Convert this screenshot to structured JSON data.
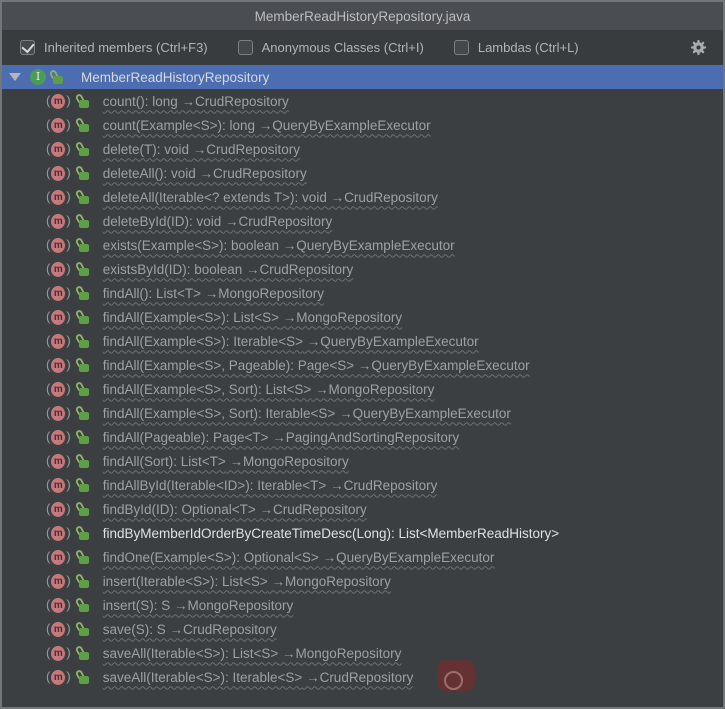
{
  "window": {
    "title": "MemberReadHistoryRepository.java"
  },
  "toolbar": {
    "checkboxes": [
      {
        "label": "Inherited members (Ctrl+F3)",
        "checked": true
      },
      {
        "label": "Anonymous Classes (Ctrl+I)",
        "checked": false
      },
      {
        "label": "Lambdas (Ctrl+L)",
        "checked": false
      }
    ],
    "gear_icon": "settings-gear"
  },
  "tree": {
    "root": {
      "label": "MemberReadHistoryRepository",
      "icon": "interface-icon",
      "selected": true,
      "expanded": true
    },
    "arrow_glyph": "→",
    "items": [
      {
        "signature": "count(): long",
        "origin": "CrudRepository",
        "inherited": true
      },
      {
        "signature": "count(Example<S>): long",
        "origin": "QueryByExampleExecutor",
        "inherited": true
      },
      {
        "signature": "delete(T): void",
        "origin": "CrudRepository",
        "inherited": true
      },
      {
        "signature": "deleteAll(): void",
        "origin": "CrudRepository",
        "inherited": true
      },
      {
        "signature": "deleteAll(Iterable<? extends T>): void",
        "origin": "CrudRepository",
        "inherited": true
      },
      {
        "signature": "deleteById(ID): void",
        "origin": "CrudRepository",
        "inherited": true
      },
      {
        "signature": "exists(Example<S>): boolean",
        "origin": "QueryByExampleExecutor",
        "inherited": true
      },
      {
        "signature": "existsById(ID): boolean",
        "origin": "CrudRepository",
        "inherited": true
      },
      {
        "signature": "findAll(): List<T>",
        "origin": "MongoRepository",
        "inherited": true
      },
      {
        "signature": "findAll(Example<S>): List<S>",
        "origin": "MongoRepository",
        "inherited": true
      },
      {
        "signature": "findAll(Example<S>): Iterable<S>",
        "origin": "QueryByExampleExecutor",
        "inherited": true
      },
      {
        "signature": "findAll(Example<S>, Pageable): Page<S>",
        "origin": "QueryByExampleExecutor",
        "inherited": true
      },
      {
        "signature": "findAll(Example<S>, Sort): List<S>",
        "origin": "MongoRepository",
        "inherited": true
      },
      {
        "signature": "findAll(Example<S>, Sort): Iterable<S>",
        "origin": "QueryByExampleExecutor",
        "inherited": true
      },
      {
        "signature": "findAll(Pageable): Page<T>",
        "origin": "PagingAndSortingRepository",
        "inherited": true
      },
      {
        "signature": "findAll(Sort): List<T>",
        "origin": "MongoRepository",
        "inherited": true
      },
      {
        "signature": "findAllById(Iterable<ID>): Iterable<T>",
        "origin": "CrudRepository",
        "inherited": true
      },
      {
        "signature": "findById(ID): Optional<T>",
        "origin": "CrudRepository",
        "inherited": true
      },
      {
        "signature": "findByMemberIdOrderByCreateTimeDesc(Long): List<MemberReadHistory>",
        "origin": "",
        "inherited": false
      },
      {
        "signature": "findOne(Example<S>): Optional<S>",
        "origin": "QueryByExampleExecutor",
        "inherited": true
      },
      {
        "signature": "insert(Iterable<S>): List<S>",
        "origin": "MongoRepository",
        "inherited": true
      },
      {
        "signature": "insert(S): S",
        "origin": "MongoRepository",
        "inherited": true
      },
      {
        "signature": "save(S): S",
        "origin": "CrudRepository",
        "inherited": true
      },
      {
        "signature": "saveAll(Iterable<S>): List<S>",
        "origin": "MongoRepository",
        "inherited": true
      },
      {
        "signature": "saveAll(Iterable<S>): Iterable<S>",
        "origin": "CrudRepository",
        "inherited": true
      }
    ]
  },
  "annotations": {
    "click_indicator_visible": true
  },
  "colors": {
    "titlebar_bg": "#4a4d51",
    "toolbar_bg": "#393c3e",
    "tree_bg": "#3b3f42",
    "selection_bg": "#4c6db1",
    "inherited_text": "#9da1a4",
    "declared_text": "#dee1e3",
    "method_icon": "#c4797c",
    "lock_icon": "#5d9e46",
    "interface_icon": "#4e9a57",
    "border": "#74777a",
    "click_indicator": "#8f2626"
  }
}
